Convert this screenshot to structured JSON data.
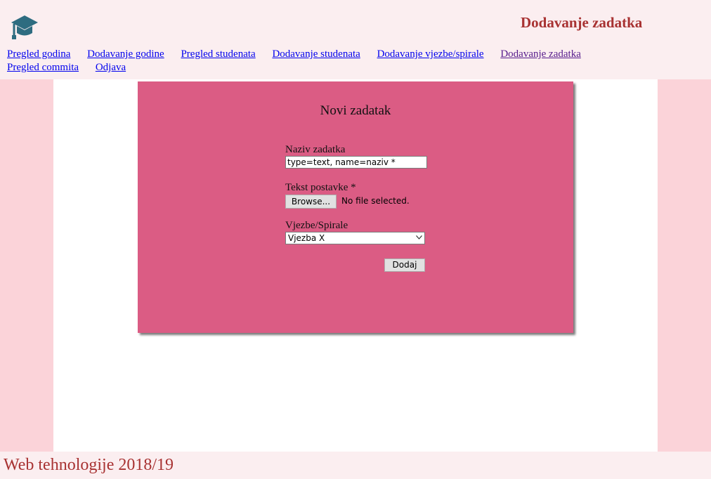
{
  "header": {
    "title": "Dodavanje zadatka",
    "logo_icon": "graduation-cap-icon",
    "logo_color": "#2e6c80"
  },
  "nav": {
    "items": [
      {
        "label": "Pregled godina"
      },
      {
        "label": "Dodavanje godine"
      },
      {
        "label": "Pregled studenata"
      },
      {
        "label": "Dodavanje studenata"
      },
      {
        "label": "Dodavanje vjezbe/spirale"
      },
      {
        "label": "Dodavanje zadatka",
        "visited": true
      },
      {
        "label": "Pregled commita"
      },
      {
        "label": "Odjava"
      }
    ]
  },
  "form": {
    "title": "Novi zadatak",
    "naziv_label": "Naziv zadatka",
    "naziv_value": "type=text, name=naziv *",
    "postavka_label": "Tekst postavke *",
    "browse_label": "Browse...",
    "file_status": "No file selected.",
    "vjezbe_label": "Vjezbe/Spirale",
    "vjezbe_selected": "Vjezba X",
    "submit_label": "Dodaj"
  },
  "footer": {
    "text": "Web tehnologije 2018/19"
  },
  "colors": {
    "accent_red": "#a83232",
    "panel_pink": "#db5c84",
    "side_pink": "#fbd3d9",
    "page_bg": "#fbeef0"
  }
}
